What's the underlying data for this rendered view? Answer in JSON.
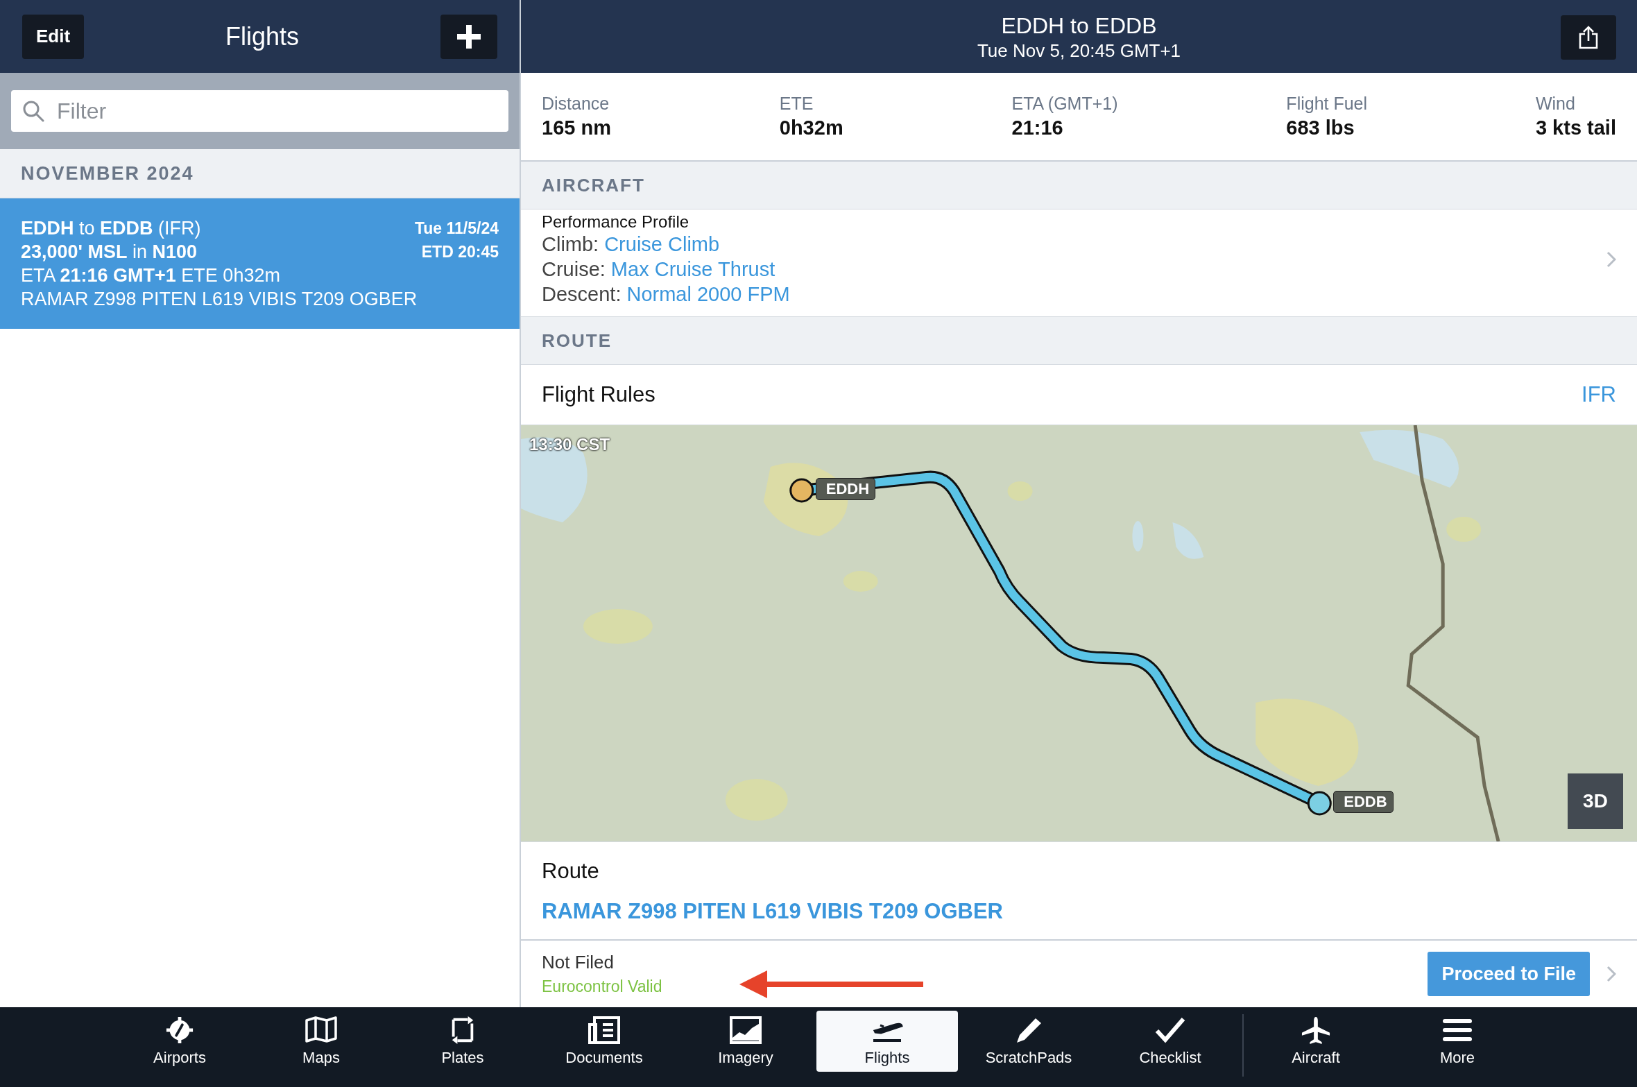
{
  "sidebar": {
    "edit_button": "Edit",
    "title": "Flights",
    "filter": {
      "placeholder": "Filter"
    },
    "sections": [
      {
        "header": "NOVEMBER 2024",
        "flights": [
          {
            "selected": true,
            "lines": [
              "**EDDH** to **EDDB** (IFR)",
              "**23,000' MSL** in **N100**",
              "ETA **21:16 GMT+1** ETE 0h32m",
              "RAMAR Z998 PITEN L619 VIBIS T209 OGBER"
            ],
            "date": "Tue 11/5/24",
            "etd": "ETD 20:45"
          }
        ]
      }
    ]
  },
  "detail": {
    "title": "EDDH to EDDB",
    "subtitle": "Tue Nov 5, 20:45 GMT+1",
    "stats": [
      {
        "label": "Distance",
        "value": "165 nm"
      },
      {
        "label": "ETE",
        "value": "0h32m"
      },
      {
        "label": "ETA (GMT+1)",
        "value": "21:16"
      },
      {
        "label": "Flight Fuel",
        "value": "683 lbs"
      },
      {
        "label": "Wind",
        "value": "3 kts tail"
      }
    ],
    "aircraft": {
      "header": "AIRCRAFT",
      "profile_title": "Performance Profile",
      "rows": [
        {
          "label": "Climb:",
          "value": "Cruise Climb"
        },
        {
          "label": "Cruise:",
          "value": "Max Cruise Thrust"
        },
        {
          "label": "Descent:",
          "value": "Normal 2000 FPM"
        }
      ]
    },
    "route_section": {
      "header": "ROUTE",
      "flight_rules": {
        "label": "Flight Rules",
        "value": "IFR"
      },
      "map": {
        "time_label": "13:30 CST",
        "button": "3D",
        "waypoints": [
          {
            "name": "EDDH",
            "kind": "departure"
          },
          {
            "name": "EDDB",
            "kind": "arrival"
          }
        ]
      },
      "route": {
        "label": "Route",
        "value": "RAMAR Z998 PITEN L619 VIBIS T209 OGBER"
      },
      "filing": {
        "status": "Not Filed",
        "validation": "Eurocontrol Valid",
        "button": "Proceed to File"
      }
    }
  },
  "tab_bar": [
    {
      "label": "Airports",
      "selected": false,
      "divider_before": false
    },
    {
      "label": "Maps",
      "selected": false,
      "divider_before": false
    },
    {
      "label": "Plates",
      "selected": false,
      "divider_before": false
    },
    {
      "label": "Documents",
      "selected": false,
      "divider_before": false
    },
    {
      "label": "Imagery",
      "selected": false,
      "divider_before": false
    },
    {
      "label": "Flights",
      "selected": true,
      "divider_before": false
    },
    {
      "label": "ScratchPads",
      "selected": false,
      "divider_before": false
    },
    {
      "label": "Checklist",
      "selected": false,
      "divider_before": false
    },
    {
      "label": "Aircraft",
      "selected": false,
      "divider_before": true
    },
    {
      "label": "More",
      "selected": false,
      "divider_before": false
    }
  ]
}
